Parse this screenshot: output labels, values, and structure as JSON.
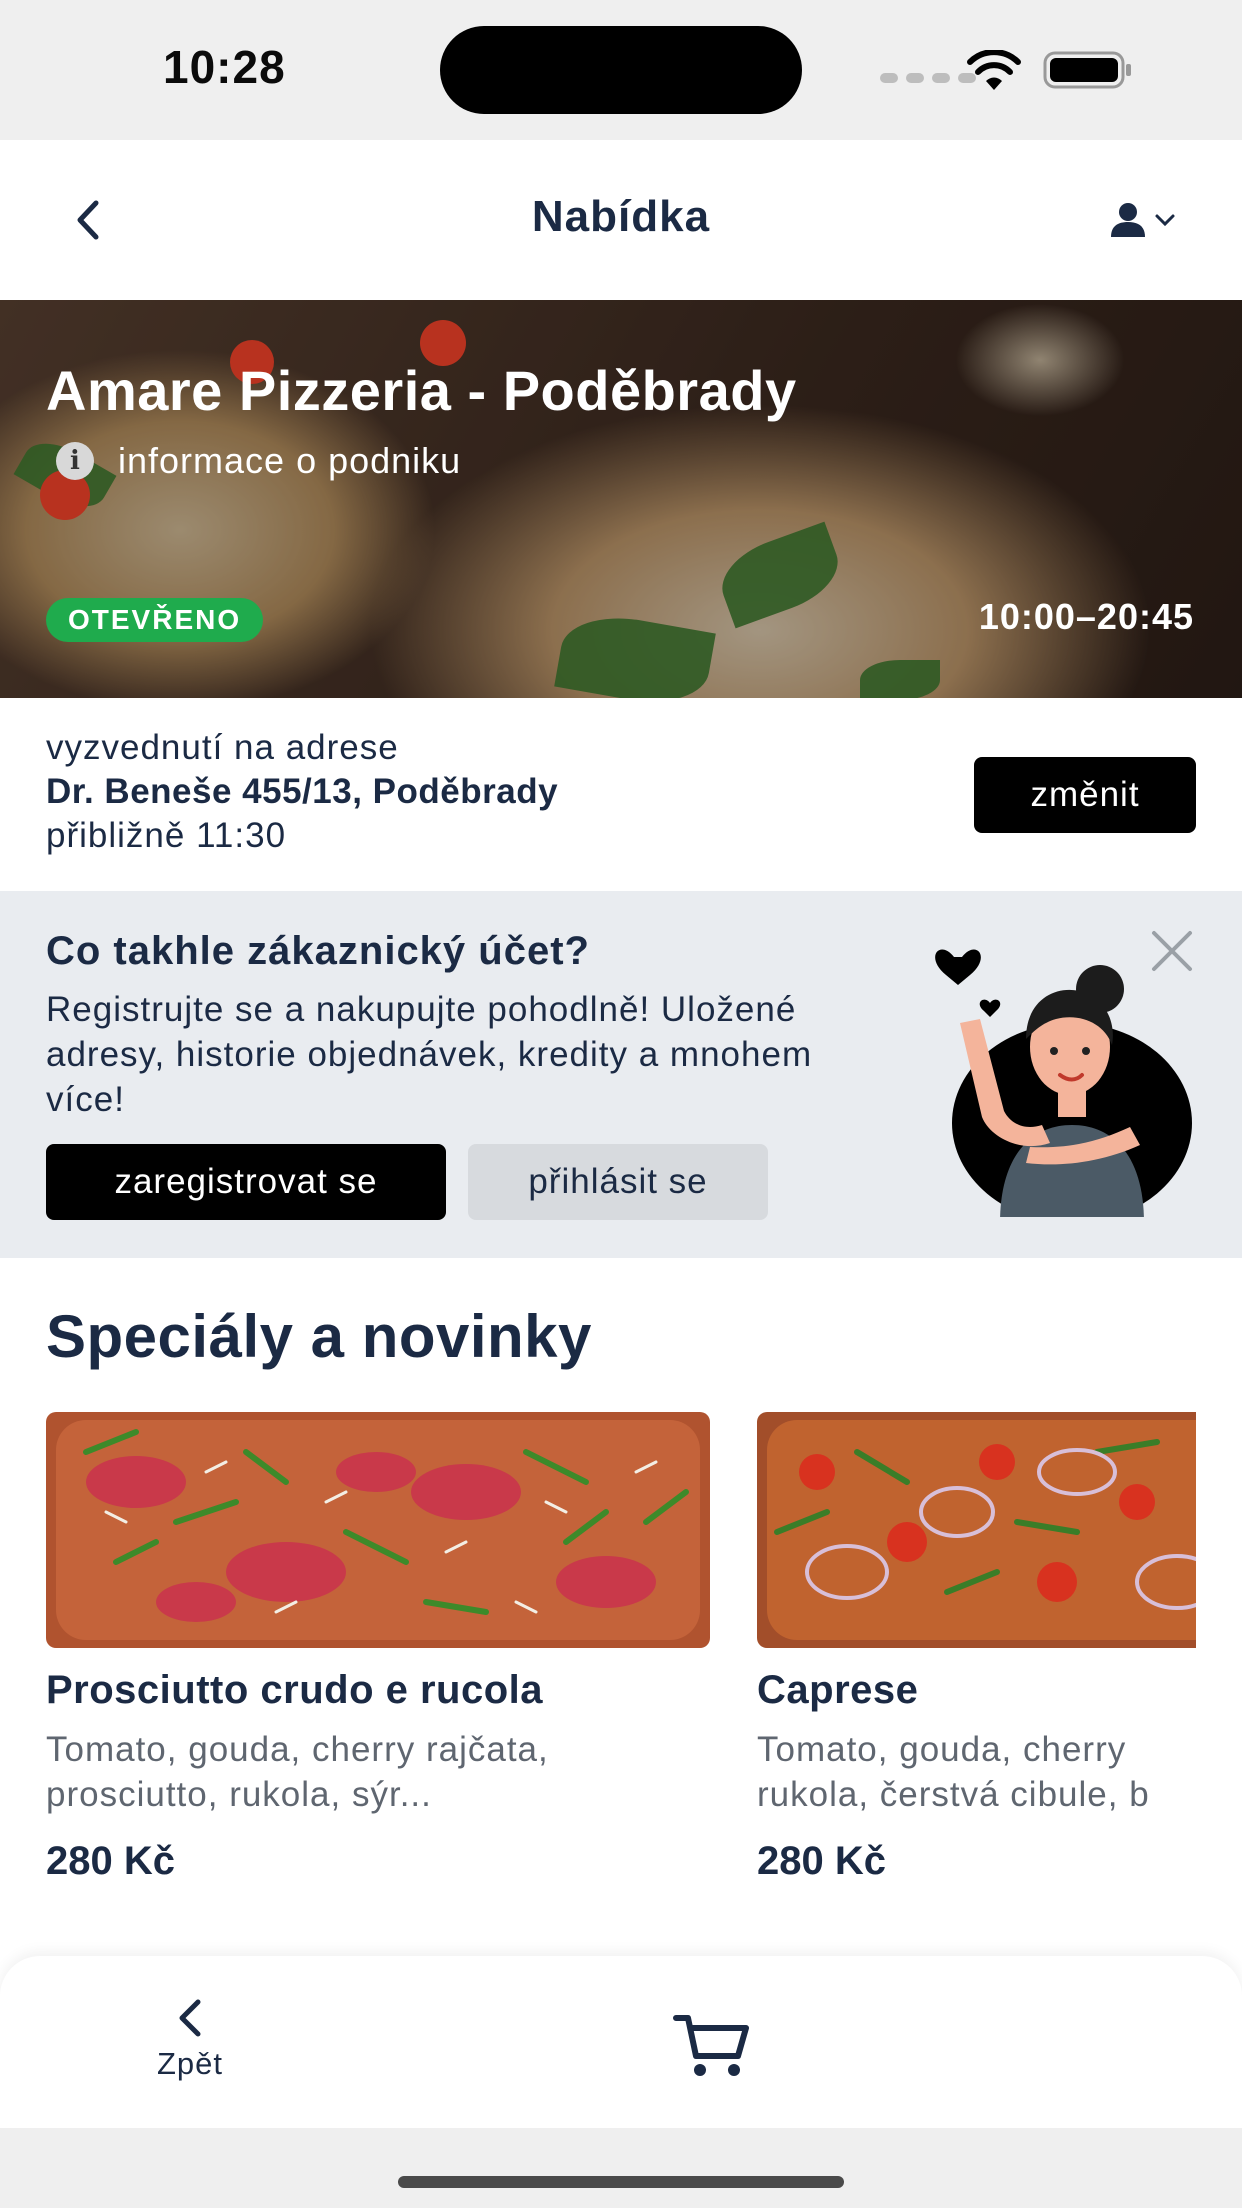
{
  "status_bar": {
    "time": "10:28"
  },
  "header": {
    "title": "Nabídka"
  },
  "restaurant": {
    "name": "Amare Pizzeria - Poděbrady",
    "info_label": "informace o podniku",
    "status_badge": "OTEVŘENO",
    "opening_hours": "10:00–20:45",
    "status_color": "#1fab4d"
  },
  "pickup": {
    "label": "vyzvednutí na adrese",
    "address": "Dr. Beneše 455/13, Poděbrady",
    "time": "přibližně 11:30",
    "change_label": "změnit"
  },
  "promo": {
    "title": "Co takhle zákaznický účet?",
    "text": "Registrujte se a nakupujte pohodlně! Uložené adresy, historie objednávek, kredity a mnohem více!",
    "register_label": "zaregistrovat se",
    "login_label": "přihlásit se"
  },
  "specials": {
    "title": "Speciály a novinky",
    "items": [
      {
        "name": "Prosciutto crudo e rucola",
        "desc_line1": "Tomato, gouda, cherry rajčata,",
        "desc_line2": "prosciutto, rukola, sýr...",
        "price": "280 Kč"
      },
      {
        "name": "Caprese",
        "desc_line1": "Tomato, gouda, cherry",
        "desc_line2": "rukola, čerstvá cibule, b",
        "price": "280 Kč"
      }
    ]
  },
  "bottom_nav": {
    "back_label": "Zpět"
  },
  "colors": {
    "text_primary": "#1b2a44",
    "accent_black": "#000000",
    "promo_bg": "#e9ecf0"
  },
  "icons": [
    "back-icon",
    "account-icon",
    "chevron-down-icon",
    "info-icon",
    "close-icon",
    "cart-icon",
    "wifi-icon",
    "battery-icon"
  ]
}
